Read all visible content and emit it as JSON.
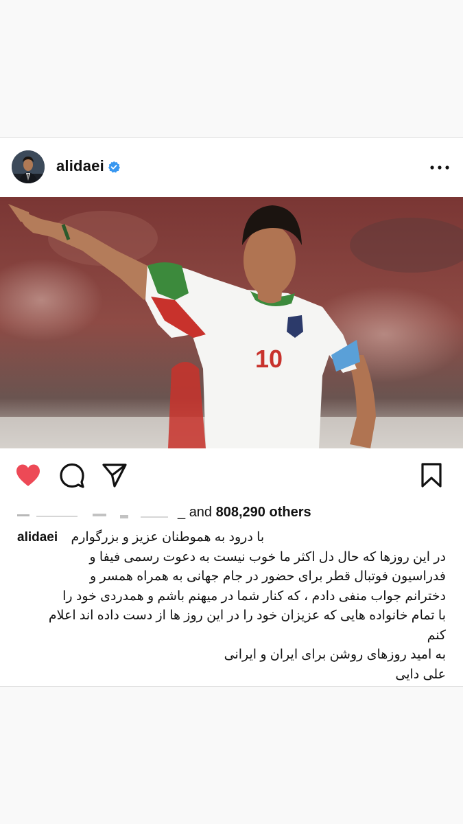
{
  "post": {
    "username": "alidaei",
    "verified": true,
    "avatar_icon": "profile-photo",
    "more_icon": "more-horizontal-icon",
    "photo": {
      "subject": "footballer-photo",
      "jersey_number": "10"
    },
    "actions": {
      "like_icon": "heart-filled-icon",
      "comment_icon": "comment-icon",
      "share_icon": "send-icon",
      "save_icon": "bookmark-icon"
    },
    "likes": {
      "prefix": "and",
      "count": "808,290",
      "suffix": "others"
    },
    "caption": {
      "username": "alidaei",
      "lines": [
        "با درود به هموطنان عزیز و بزرگوارم",
        "در این روزها که حال دل اکثر ما خوب نیست به دعوت رسمی فیفا و",
        "فدراسیون فوتبال قطر برای حضور در جام جهانی به همراه همسر و",
        "دخترانم جواب منفی دادم ، که کنار شما در میهنم باشم و همدردی خود را",
        "با تمام خانواده هایی که عزیزان خود را در این روز ها از دست داده اند اعلام",
        "کنم",
        "به امید روزهای روشن برای ایران و ایرانی",
        "علی دایی"
      ]
    },
    "colors": {
      "like_red": "#ed4956",
      "verified_blue": "#3897f0",
      "text": "#111111"
    }
  }
}
